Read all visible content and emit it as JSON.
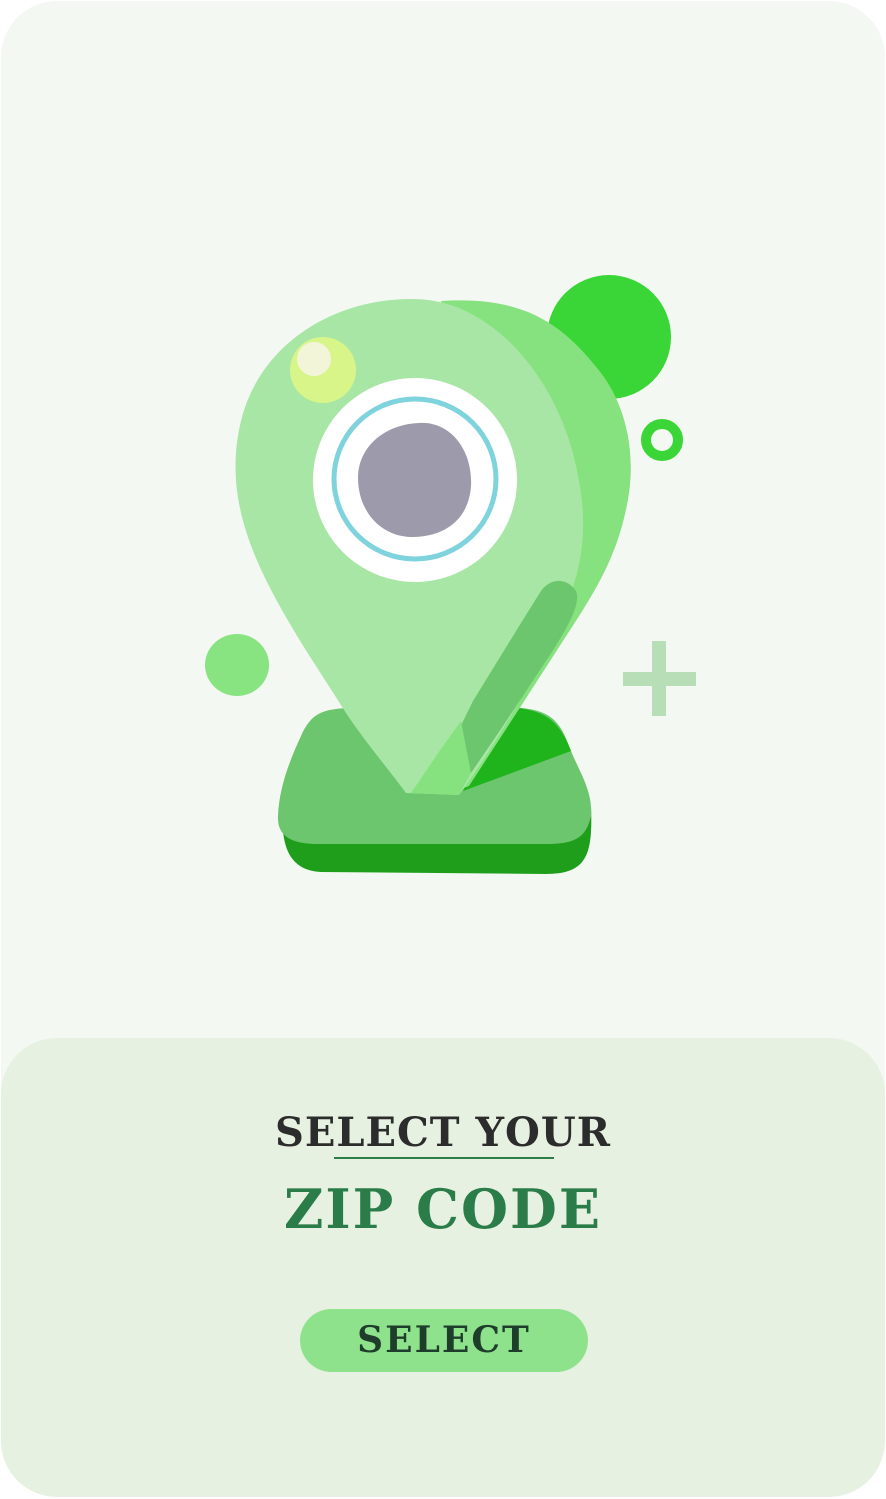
{
  "headline": {
    "line1": "SELECT YOUR",
    "line2": "ZIP CODE"
  },
  "button": {
    "label": "SELECT"
  },
  "illustration": {
    "icon": "map-pin-icon",
    "colors": {
      "pin_light": "#a8e6a5",
      "pin_shade": "#86e17f",
      "base_top": "#6cc66d",
      "base_bottom": "#1e9e1b",
      "bubble_big": "#3ad637",
      "bubble_small": "#88e481",
      "plus": "#b7deb7",
      "eye_pupil": "#9c9aab",
      "eye_ring": "#7fd3dd",
      "highlight": "#d8f58a"
    }
  },
  "theme": {
    "background": "#f3f8f2",
    "panel": "#e6f1e1",
    "accent": "#2a7c48",
    "button": "#8fe28c"
  }
}
